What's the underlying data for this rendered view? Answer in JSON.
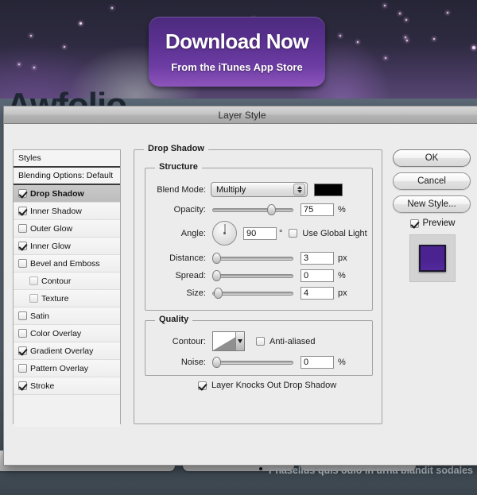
{
  "background": {
    "headline": "Awfolio",
    "download_banner": {
      "title": "Download Now",
      "subtitle": "From the iTunes App Store"
    },
    "bullet_text": "Phasellus quis odio in urna blandit sodales"
  },
  "dialog": {
    "title": "Layer Style",
    "styles_list": [
      {
        "label": "Styles",
        "type": "header",
        "checkbox": null,
        "selected": false,
        "indent": false
      },
      {
        "label": "Blending Options: Default",
        "type": "header",
        "checkbox": null,
        "selected": false,
        "indent": false
      },
      {
        "label": "Drop Shadow",
        "type": "effect",
        "checkbox": true,
        "selected": true,
        "indent": false
      },
      {
        "label": "Inner Shadow",
        "type": "effect",
        "checkbox": true,
        "selected": false,
        "indent": false
      },
      {
        "label": "Outer Glow",
        "type": "effect",
        "checkbox": false,
        "selected": false,
        "indent": false
      },
      {
        "label": "Inner Glow",
        "type": "effect",
        "checkbox": true,
        "selected": false,
        "indent": false
      },
      {
        "label": "Bevel and Emboss",
        "type": "effect",
        "checkbox": false,
        "selected": false,
        "indent": false
      },
      {
        "label": "Contour",
        "type": "effect",
        "checkbox": false,
        "selected": false,
        "indent": true
      },
      {
        "label": "Texture",
        "type": "effect",
        "checkbox": false,
        "selected": false,
        "indent": true
      },
      {
        "label": "Satin",
        "type": "effect",
        "checkbox": false,
        "selected": false,
        "indent": false
      },
      {
        "label": "Color Overlay",
        "type": "effect",
        "checkbox": false,
        "selected": false,
        "indent": false
      },
      {
        "label": "Gradient Overlay",
        "type": "effect",
        "checkbox": true,
        "selected": false,
        "indent": false
      },
      {
        "label": "Pattern Overlay",
        "type": "effect",
        "checkbox": false,
        "selected": false,
        "indent": false
      },
      {
        "label": "Stroke",
        "type": "effect",
        "checkbox": true,
        "selected": false,
        "indent": false
      }
    ],
    "panel": {
      "group_title": "Drop Shadow",
      "structure": {
        "title": "Structure",
        "blend_mode_label": "Blend Mode:",
        "blend_mode_value": "Multiply",
        "shadow_color": "#000000",
        "opacity_label": "Opacity:",
        "opacity_value": "75",
        "opacity_unit": "%",
        "angle_label": "Angle:",
        "angle_value": "90",
        "angle_unit": "°",
        "use_global_light_label": "Use Global Light",
        "use_global_light_checked": false,
        "distance_label": "Distance:",
        "distance_value": "3",
        "distance_unit": "px",
        "spread_label": "Spread:",
        "spread_value": "0",
        "spread_unit": "%",
        "size_label": "Size:",
        "size_value": "4",
        "size_unit": "px"
      },
      "quality": {
        "title": "Quality",
        "contour_label": "Contour:",
        "anti_aliased_label": "Anti-aliased",
        "anti_aliased_checked": false,
        "noise_label": "Noise:",
        "noise_value": "0",
        "noise_unit": "%"
      },
      "layer_knocks_out_label": "Layer Knocks Out Drop Shadow",
      "layer_knocks_out_checked": true
    },
    "buttons": {
      "ok": "OK",
      "cancel": "Cancel",
      "new_style": "New Style...",
      "preview_label": "Preview",
      "preview_checked": true,
      "preview_swatch_color": "#4a2391"
    }
  }
}
